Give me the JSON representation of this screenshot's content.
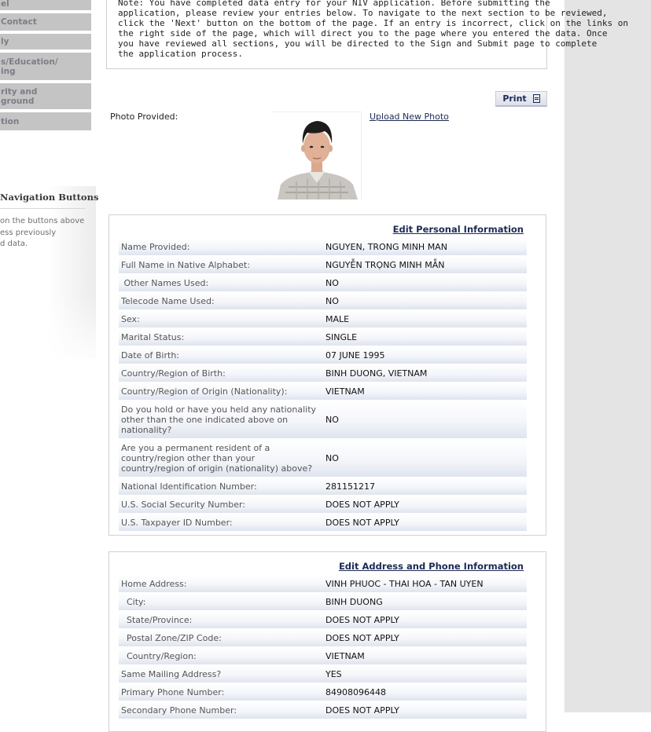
{
  "sidebar": {
    "items": [
      {
        "label": "el"
      },
      {
        "label": "Contact"
      },
      {
        "label": "ly"
      },
      {
        "label": "s/Education/\ning"
      },
      {
        "label": "rity and\nground"
      },
      {
        "label": "tion"
      }
    ],
    "nav_panel": {
      "title": "Navigation Buttons",
      "description": "on the buttons above\ness previously\nd data."
    }
  },
  "note": "Note: You have completed data entry for your NIV application. Before submitting the\napplication, please review your entries below. To navigate to the next section to be reviewed,\nclick the 'Next' button on the bottom of the page. If an entry is incorrect, click on the links on\nthe right side of the page, which will direct you to the page where you entered the data. Once\nyou have reviewed all sections, you will be directed to the Sign and Submit page to complete\nthe application process.",
  "print_label": "Print",
  "photo": {
    "label": "Photo Provided:",
    "upload_link": "Upload New Photo"
  },
  "personal": {
    "edit_link": "Edit Personal Information",
    "rows": [
      {
        "label": "Name Provided:",
        "value": "NGUYEN, TRONG MINH MAN"
      },
      {
        "label": "Full Name in Native Alphabet:",
        "value": "NGUYỄN TRỌNG MINH MẪN"
      },
      {
        "label": " Other Names Used:",
        "value": "NO"
      },
      {
        "label": "Telecode Name Used:",
        "value": "NO"
      },
      {
        "label": "Sex:",
        "value": "MALE"
      },
      {
        "label": "Marital Status:",
        "value": "SINGLE"
      },
      {
        "label": "Date of Birth:",
        "value": "07 JUNE 1995"
      },
      {
        "label": "Country/Region of Birth:",
        "value": "BINH DUONG, VIETNAM"
      },
      {
        "label": "Country/Region of Origin (Nationality):",
        "value": "VIETNAM"
      },
      {
        "label": "Do you hold or have you held any nationality\nother than the one indicated above on\nnationality?",
        "value": "NO"
      },
      {
        "label": "Are you a permanent resident of a\ncountry/region other than your\ncountry/region of origin (nationality) above?",
        "value": "NO"
      },
      {
        "label": "National Identification Number:",
        "value": "281151217"
      },
      {
        "label": "U.S. Social Security Number:",
        "value": "DOES NOT APPLY"
      },
      {
        "label": "U.S. Taxpayer ID Number:",
        "value": "DOES NOT APPLY"
      }
    ]
  },
  "address": {
    "edit_link": "Edit Address and Phone Information",
    "rows": [
      {
        "label": "Home Address:",
        "value": "VINH PHUOC - THAI HOA - TAN UYEN"
      },
      {
        "label": "  City:",
        "value": "BINH DUONG"
      },
      {
        "label": "  State/Province:",
        "value": "DOES NOT APPLY"
      },
      {
        "label": "  Postal Zone/ZIP Code:",
        "value": "DOES NOT APPLY"
      },
      {
        "label": "  Country/Region:",
        "value": "VIETNAM"
      },
      {
        "label": "Same Mailing Address?",
        "value": "YES"
      },
      {
        "label": "Primary Phone Number:",
        "value": "84908096448"
      },
      {
        "label": "Secondary Phone Number:",
        "value": "DOES NOT APPLY"
      }
    ]
  }
}
